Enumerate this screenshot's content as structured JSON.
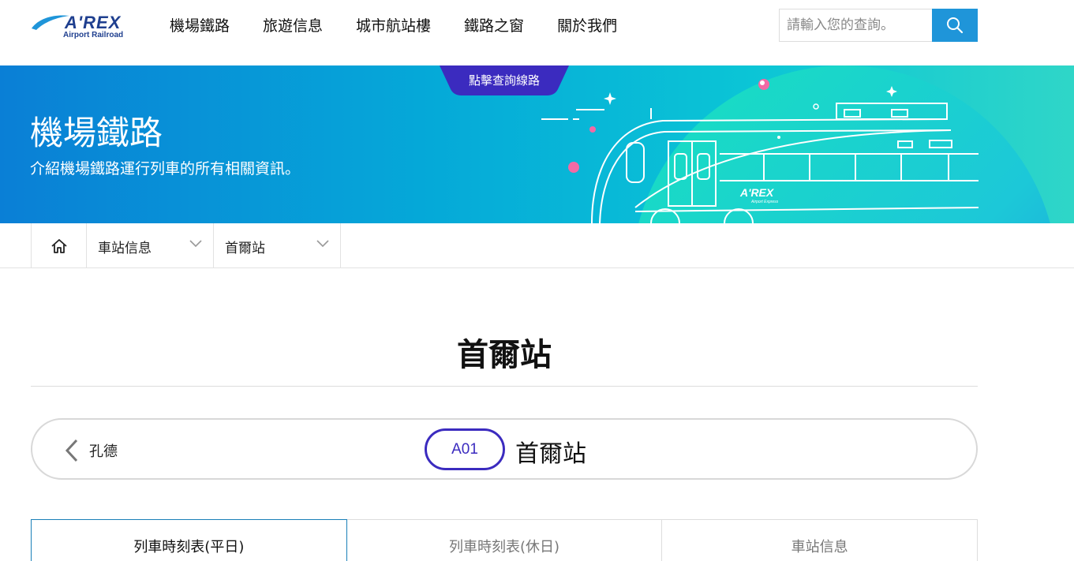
{
  "header": {
    "logo_main": "A'REX",
    "logo_sub": "Airport Railroad",
    "nav": [
      "機場鐵路",
      "旅遊信息",
      "城市航站樓",
      "鐵路之窗",
      "關於我們"
    ],
    "search_placeholder": "請輸入您的查詢。",
    "search_icon": "search-icon"
  },
  "banner": {
    "route_tab": "點擊查詢線路",
    "title": "機場鐵路",
    "subtitle": "介紹機場鐵路運行列車的所有相關資訊。",
    "train_logo": "A'REX",
    "train_logo_sub": "Airport Express"
  },
  "breadcrumb": {
    "home_icon": "home-icon",
    "items": [
      "車站信息",
      "首爾站"
    ]
  },
  "page": {
    "title": "首爾站"
  },
  "station_nav": {
    "prev_label": "孔德",
    "code": "A01",
    "name": "首爾站"
  },
  "tabs": [
    "列車時刻表(平日)",
    "列車時刻表(休日)",
    "車站信息"
  ],
  "colors": {
    "accent_blue": "#1f95d9",
    "badge_purple": "#3b2bbf",
    "logo_navy": "#1f3f8f"
  }
}
